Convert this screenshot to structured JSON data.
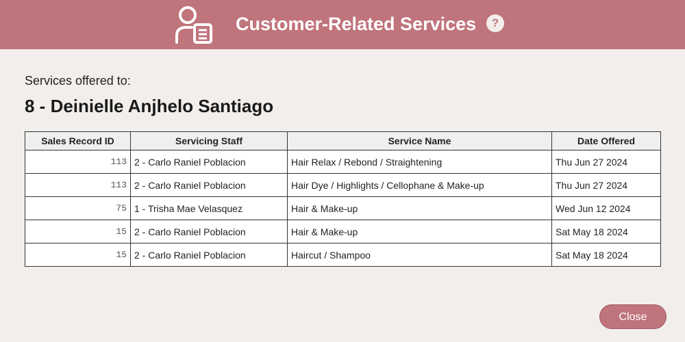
{
  "header": {
    "title": "Customer-Related Services",
    "icon": "customer-document-icon",
    "help_label": "?",
    "background_color": "#c0747c"
  },
  "content": {
    "offered_label": "Services offered to:",
    "customer_name": "8 - Deinielle Anjhelo Santiago"
  },
  "table": {
    "columns": [
      "Sales Record ID",
      "Servicing Staff",
      "Service Name",
      "Date Offered"
    ],
    "rows": [
      [
        "113",
        "2 - Carlo Raniel Poblacion",
        "Hair Relax / Rebond / Straightening",
        "Thu Jun 27 2024"
      ],
      [
        "113",
        "2 - Carlo Raniel Poblacion",
        "Hair Dye / Highlights / Cellophane & Make-up",
        "Thu Jun 27 2024"
      ],
      [
        "75",
        "1 - Trisha Mae Velasquez",
        "Hair & Make-up",
        "Wed Jun 12 2024"
      ],
      [
        "15",
        "2 - Carlo Raniel Poblacion",
        "Hair & Make-up",
        "Sat May 18 2024"
      ],
      [
        "15",
        "2 - Carlo Raniel Poblacion",
        "Haircut / Shampoo",
        "Sat May 18 2024"
      ]
    ]
  },
  "footer": {
    "close_label": "Close"
  }
}
